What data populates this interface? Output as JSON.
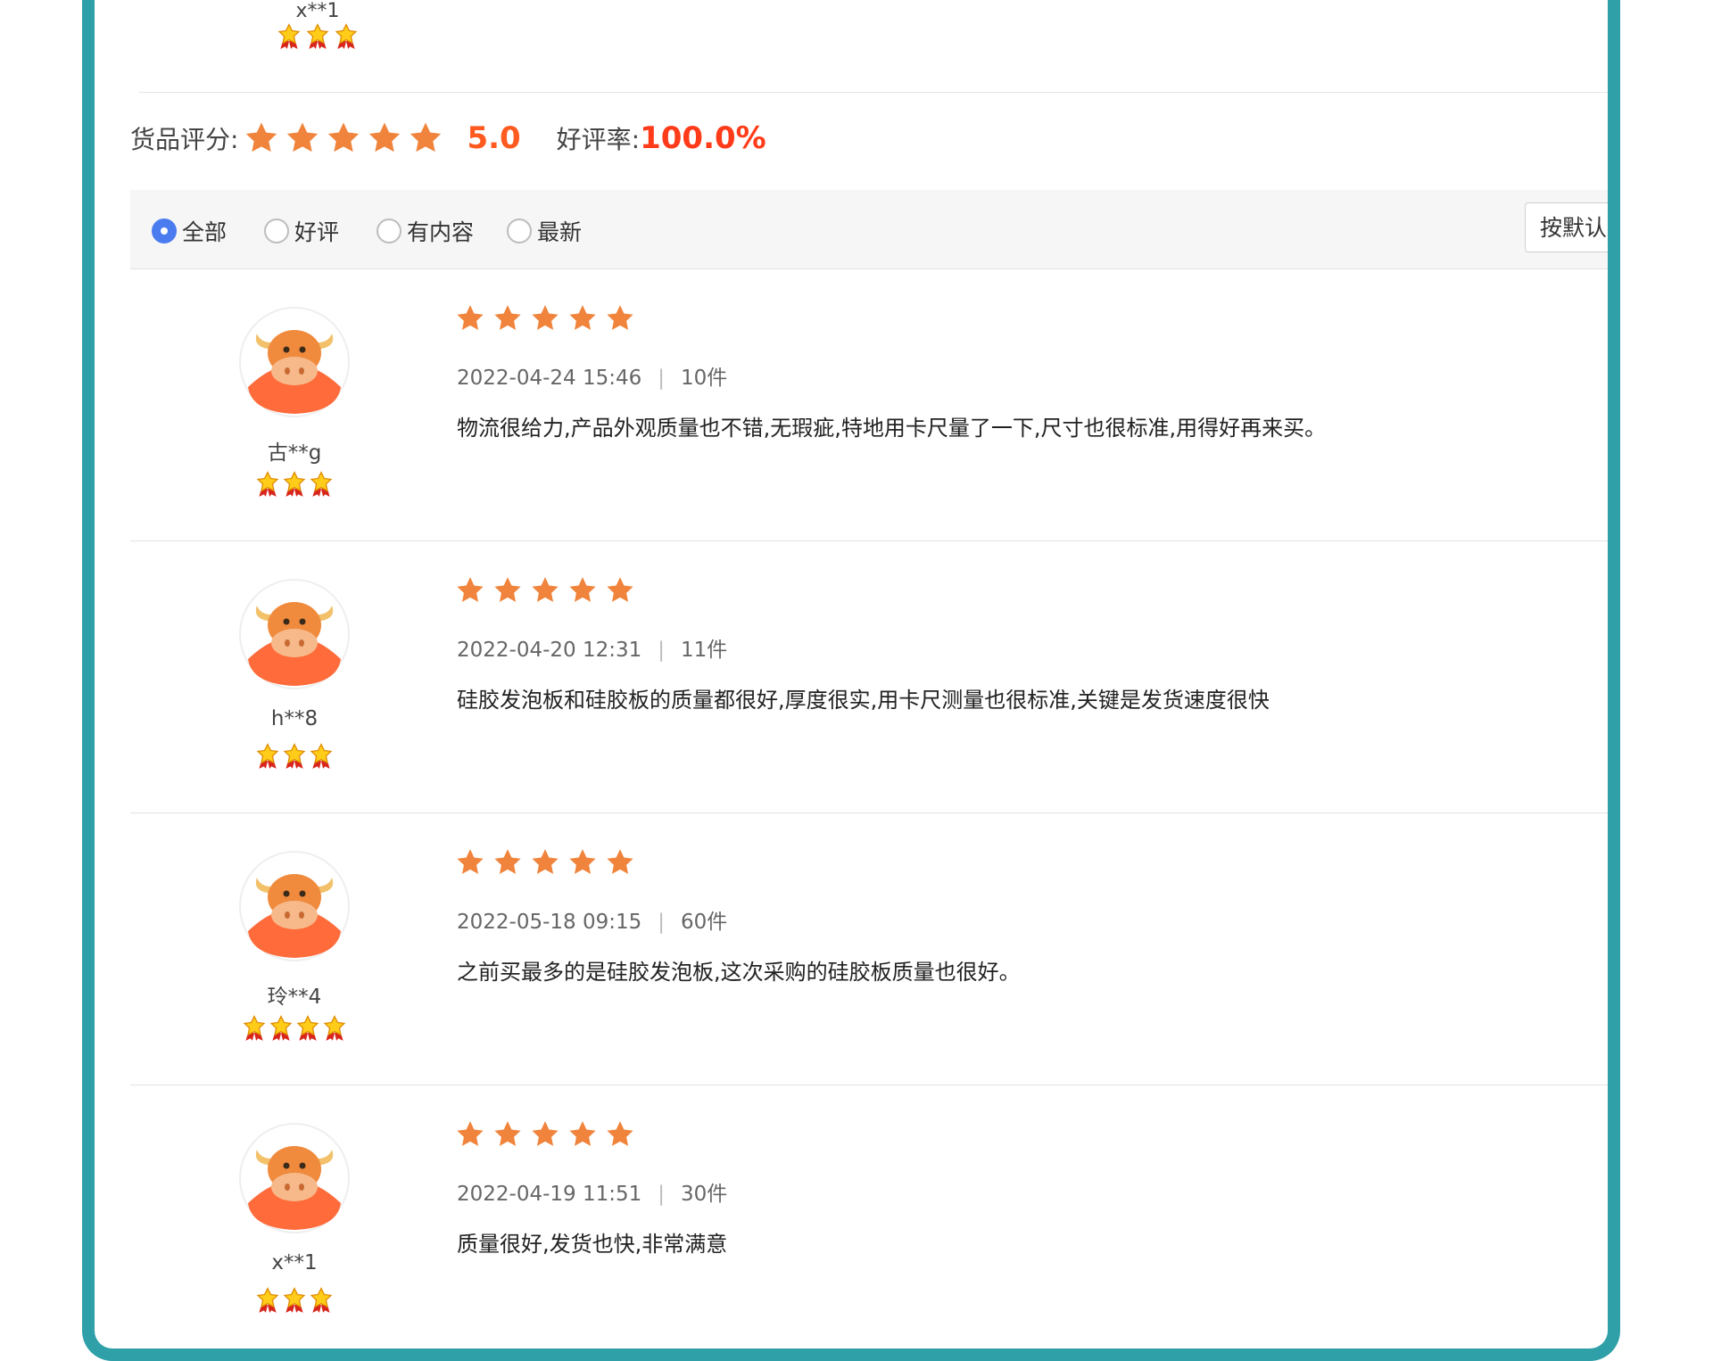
{
  "top_partial_review": {
    "username": "x**1",
    "level_count": 3
  },
  "summary": {
    "score_label": "货品评分:",
    "star_count": 5,
    "score": "5.0",
    "rate_label": "好评率:",
    "rate": "100.0%"
  },
  "filters": {
    "options": [
      {
        "label": "全部",
        "selected": true
      },
      {
        "label": "好评",
        "selected": false
      },
      {
        "label": "有内容",
        "selected": false
      },
      {
        "label": "最新",
        "selected": false
      }
    ],
    "sort_label": "按默认"
  },
  "reviews": [
    {
      "username": "古**g",
      "level_count": 3,
      "rating": 5,
      "datetime": "2022-04-24 15:46",
      "separator": "|",
      "quantity": "10件",
      "content": "物流很给力,产品外观质量也不错,无瑕疵,特地用卡尺量了一下,尺寸也很标准,用得好再来买。"
    },
    {
      "username": "h**8",
      "level_count": 3,
      "rating": 5,
      "datetime": "2022-04-20 12:31",
      "separator": "|",
      "quantity": "11件",
      "content": "硅胶发泡板和硅胶板的质量都很好,厚度很实,用卡尺测量也很标准,关键是发货速度很快"
    },
    {
      "username": "玲**4",
      "level_count": 4,
      "rating": 5,
      "datetime": "2022-05-18 09:15",
      "separator": "|",
      "quantity": "60件",
      "content": "之前买最多的是硅胶发泡板,这次采购的硅胶板质量也很好。"
    },
    {
      "username": "x**1",
      "level_count": 3,
      "rating": 5,
      "datetime": "2022-04-19 11:51",
      "separator": "|",
      "quantity": "30件",
      "content": "质量很好,发货也快,非常满意"
    }
  ],
  "colors": {
    "frame": "#2f9fa8",
    "star": "#f0843c",
    "score": "#ff5a1f",
    "rate": "#ff3b1a",
    "radio_selected": "#4a7cf0"
  },
  "icons": {
    "avatar": "cow-avatar-icon",
    "level": "medal-star-icon",
    "rating": "star-icon"
  }
}
